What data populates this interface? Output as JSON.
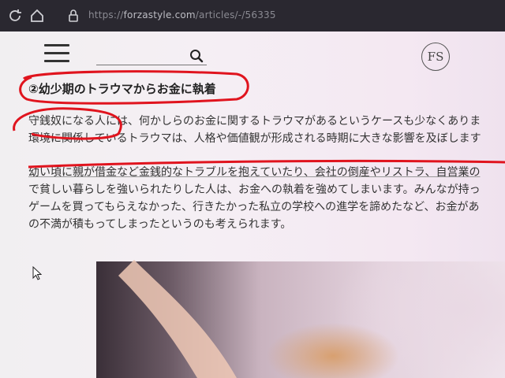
{
  "browser": {
    "url_prefix": "https://",
    "url_domain": "forzastyle.com",
    "url_path": "/articles/-/56335"
  },
  "site": {
    "logo_text": "FS"
  },
  "article": {
    "heading": "②幼少期のトラウマからお金に執着",
    "paragraph1": [
      "守銭奴になる人には、何かしらのお金に関するトラウマがあるというケースも少なくありま",
      "環境に関係しているトラウマは、人格や価値観が形成される時期に大きな影響を及ぼします"
    ],
    "paragraph2": [
      "幼い頃に親が借金など金銭的なトラブルを抱えていたり、会社の倒産やリストラ、自営業の",
      "で貧しい暮らしを強いられたりした人は、お金への執着を強めてしまいます。みんなが持っ",
      "ゲームを買ってもらえなかった、行きたかった私立の学校への進学を諦めたなど、お金があ",
      "の不満が積もってしまったというのも考えられます。"
    ]
  },
  "colors": {
    "annotation_red": "#e0141e",
    "topbar": "#2a2830"
  }
}
